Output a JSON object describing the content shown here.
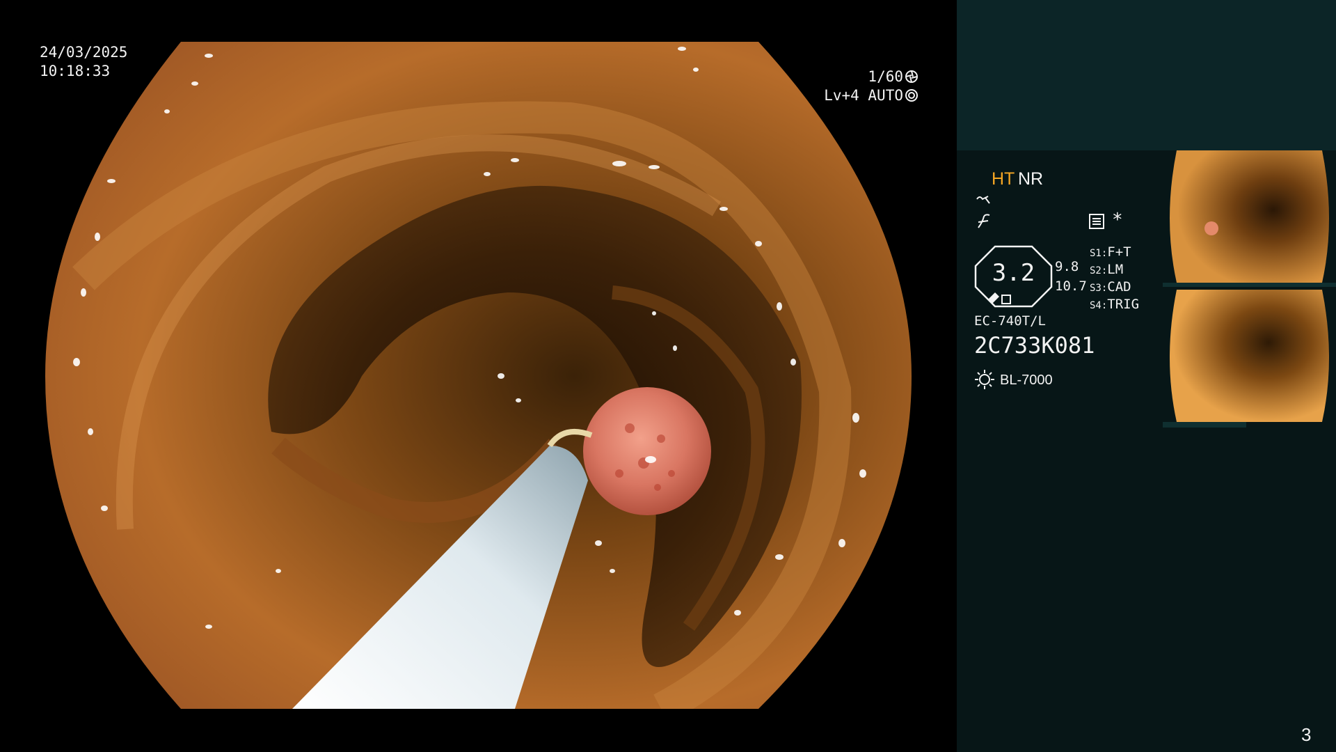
{
  "overlay": {
    "date": "24/03/2025",
    "time": "10:18:33",
    "shutter": "1/60",
    "level": "Lv+4 AUTO"
  },
  "panel": {
    "mode_ht": "HT",
    "mode_nr": "NR",
    "zoom_value": "3.2",
    "ratio_top": "9.8",
    "ratio_bottom": "10.7",
    "switches": [
      {
        "key": "S1:",
        "value": "F+T"
      },
      {
        "key": "S2:",
        "value": "LM"
      },
      {
        "key": "S3:",
        "value": "CAD"
      },
      {
        "key": "S4:",
        "value": "TRIG"
      }
    ],
    "scope_model": "EC-740T/L",
    "serial": "2C733K081",
    "light_source": "BL-7000"
  },
  "page_number": "3",
  "icons": {
    "shutter": "aperture-icon",
    "level": "auto-iris-icon",
    "structure": "structure-enhance-icon",
    "color": "color-enhance-icon",
    "menu": "menu-list-icon",
    "star": "asterisk-icon",
    "lamp": "light-source-icon"
  },
  "colors": {
    "accent": "#f5a623",
    "panel_bg": "#071617",
    "panel_top_bg": "#0c2527",
    "text": "#f4f4f4"
  }
}
